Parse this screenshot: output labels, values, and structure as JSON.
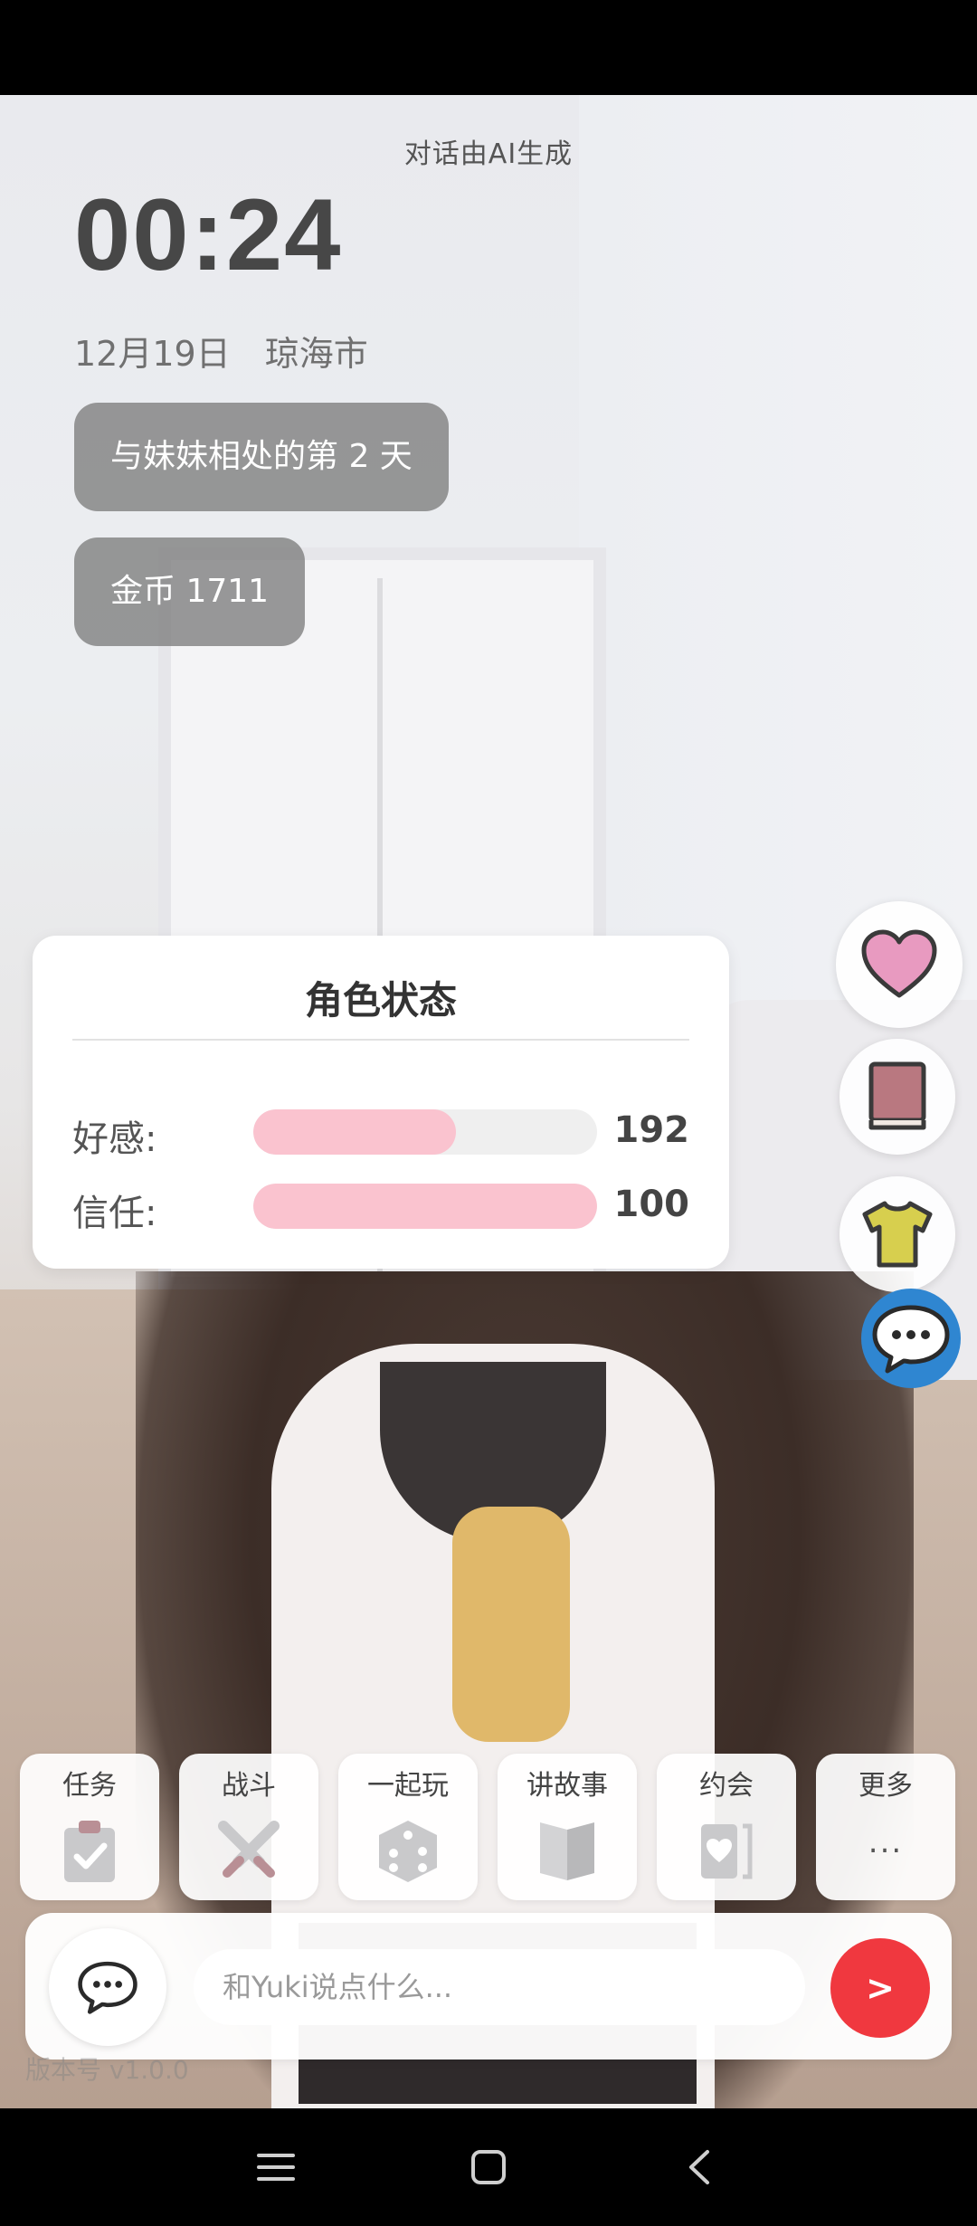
{
  "header": {
    "ai_notice": "对话由AI生成",
    "clock": "00:24",
    "date": "12月19日",
    "location": "琼海市"
  },
  "info": {
    "days_label": "与妹妹相处的第 2 天",
    "coins_label": "金币 1711"
  },
  "status_card": {
    "title": "角色状态",
    "stats": [
      {
        "label": "好感:",
        "value": "192",
        "fill_fraction": 0.59
      },
      {
        "label": "信任:",
        "value": "100",
        "fill_fraction": 1.0
      }
    ]
  },
  "side_buttons": [
    {
      "name": "heart-button",
      "icon": "heart-icon"
    },
    {
      "name": "book-button",
      "icon": "book-icon"
    },
    {
      "name": "outfit-button",
      "icon": "shirt-icon"
    },
    {
      "name": "chat-button",
      "icon": "speech-bubble-icon"
    }
  ],
  "actions": [
    {
      "label": "任务",
      "icon": "clipboard-check-icon"
    },
    {
      "label": "战斗",
      "icon": "crossed-swords-icon"
    },
    {
      "label": "一起玩",
      "icon": "dice-icon"
    },
    {
      "label": "讲故事",
      "icon": "open-book-icon"
    },
    {
      "label": "约会",
      "icon": "heart-card-icon"
    },
    {
      "label": "更多",
      "icon": "ellipsis-icon",
      "dots": "..."
    }
  ],
  "input": {
    "placeholder": "和Yuki说点什么...",
    "value": "",
    "send_label": ">"
  },
  "version_label": "版本号 v1.0.0",
  "colors": {
    "bar_fill": "#fac3cf",
    "send_button": "#f0383f",
    "chat_fab": "#2f86d1"
  }
}
